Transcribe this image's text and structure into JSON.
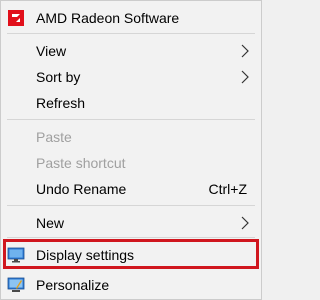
{
  "menu": {
    "items": [
      {
        "label": "AMD Radeon Software",
        "icon": "amd-logo-icon"
      },
      {
        "label": "View",
        "submenu": true
      },
      {
        "label": "Sort by",
        "submenu": true
      },
      {
        "label": "Refresh"
      },
      {
        "label": "Paste",
        "disabled": true
      },
      {
        "label": "Paste shortcut",
        "disabled": true
      },
      {
        "label": "Undo Rename",
        "shortcut": "Ctrl+Z"
      },
      {
        "label": "New",
        "submenu": true
      },
      {
        "label": "Display settings",
        "icon": "monitor-icon",
        "highlighted": true
      },
      {
        "label": "Personalize",
        "icon": "personalize-icon"
      }
    ]
  },
  "colors": {
    "menu_bg": "#f2f2f2",
    "disabled_text": "#a0a0a0",
    "highlight_border": "#d0161e",
    "amd_red": "#e10f1a",
    "monitor_blue": "#2f7bd6"
  }
}
